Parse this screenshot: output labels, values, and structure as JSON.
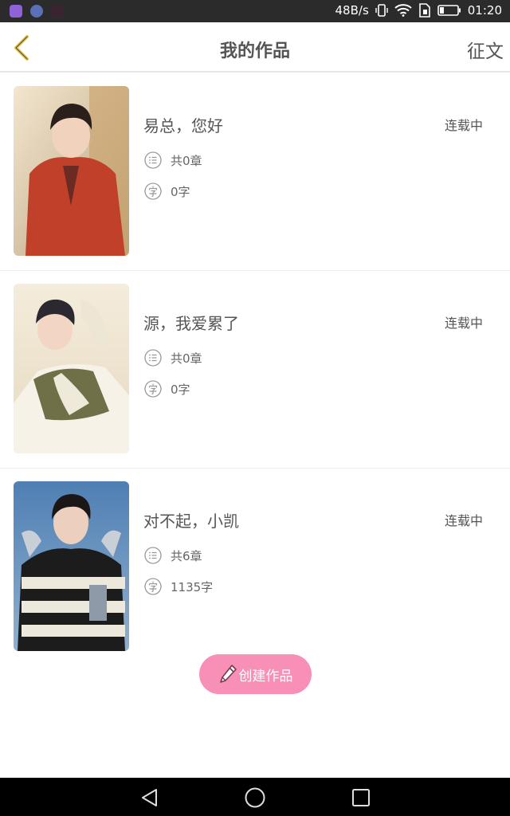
{
  "status_bar": {
    "network_speed": "48B/s",
    "time": "01:20",
    "icons": [
      "vibrate-icon",
      "wifi-icon",
      "sim-icon",
      "battery-icon"
    ]
  },
  "header": {
    "title": "我的作品",
    "back_icon": "chevron-left-icon",
    "right_link": "征文"
  },
  "works": [
    {
      "title": "易总，您好",
      "status": "连载中",
      "chapters": "共0章",
      "words": "0字"
    },
    {
      "title": "源，我爱累了",
      "status": "连载中",
      "chapters": "共0章",
      "words": "0字"
    },
    {
      "title": "对不起，小凯",
      "status": "连载中",
      "chapters": "共6章",
      "words": "1135字"
    }
  ],
  "create_button": {
    "label": "创建作品",
    "icon": "pencil-icon"
  },
  "nav_bar": {
    "icons": [
      "back-triangle-icon",
      "home-circle-icon",
      "recents-square-icon"
    ]
  },
  "colors": {
    "accent_pink": "#f78fb6",
    "back_arrow": "#e7c23a",
    "text": "#555555"
  }
}
